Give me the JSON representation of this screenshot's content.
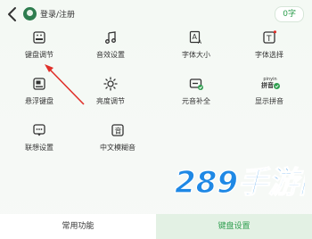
{
  "header": {
    "login_label": "登录/注册",
    "count_label": "0字"
  },
  "items": [
    {
      "label": "键盘调节",
      "icon": "keyboard-adjust-icon"
    },
    {
      "label": "音效设置",
      "icon": "music-note-icon"
    },
    {
      "label": "字体大小",
      "icon": "font-size-icon"
    },
    {
      "label": "字体选择",
      "icon": "font-select-icon"
    },
    {
      "label": "悬浮键盘",
      "icon": "floating-keyboard-icon"
    },
    {
      "label": "亮度调节",
      "icon": "brightness-icon"
    },
    {
      "label": "元音补全",
      "icon": "vowel-complete-icon"
    },
    {
      "label": "显示拼音",
      "icon": "show-pinyin-icon",
      "badge_top": "pinyin",
      "badge_bottom": "拼音"
    },
    {
      "label": "联想设置",
      "icon": "association-icon"
    },
    {
      "label": "中文模糊音",
      "icon": "fuzzy-sound-icon"
    }
  ],
  "watermark": {
    "text": "289手游网"
  },
  "tabs": [
    {
      "label": "常用功能",
      "active": false
    },
    {
      "label": "键盘设置",
      "active": true
    }
  ],
  "colors": {
    "accent": "#2f9e4f",
    "arrow": "#e0302a",
    "watermark": "#1e88e5"
  }
}
